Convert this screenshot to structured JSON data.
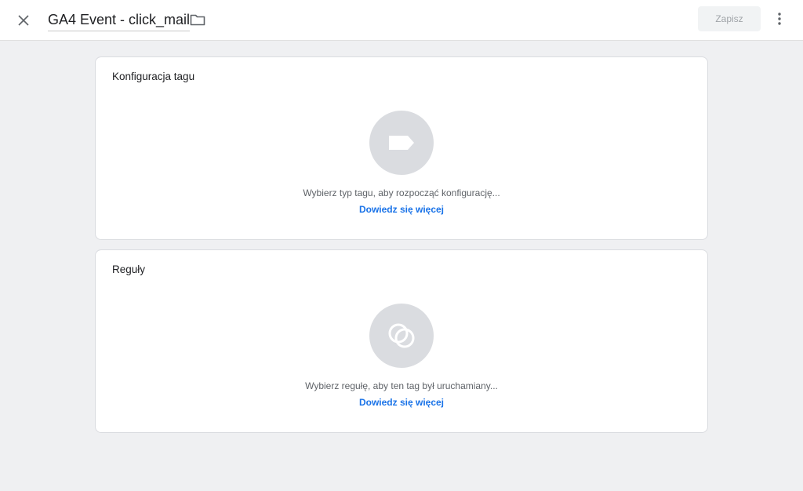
{
  "header": {
    "title": "GA4 Event - click_mail",
    "save_label": "Zapisz"
  },
  "tag_config": {
    "title": "Konfiguracja tagu",
    "hint": "Wybierz typ tagu, aby rozpocząć konfigurację...",
    "learn_more": "Dowiedz się więcej",
    "icon": "tag-icon"
  },
  "triggers": {
    "title": "Reguły",
    "hint": "Wybierz regułę, aby ten tag był uruchamiany...",
    "learn_more": "Dowiedz się więcej",
    "icon": "trigger-icon"
  },
  "colors": {
    "accent": "#1a73e8",
    "page_bg": "#eff0f2",
    "icon_circle": "#dadce0"
  }
}
